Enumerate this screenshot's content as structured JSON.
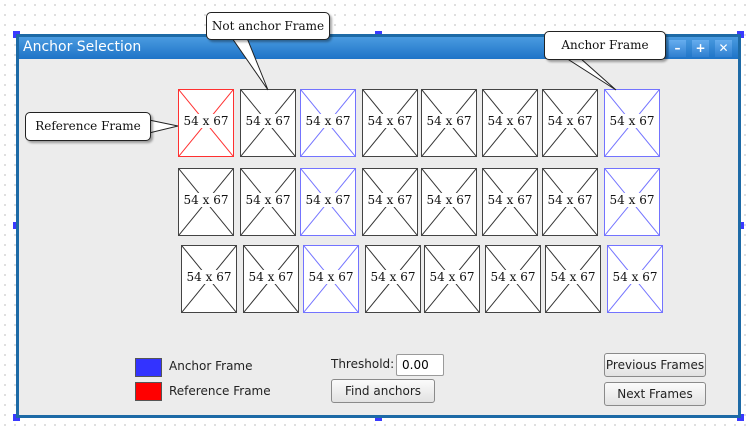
{
  "window": {
    "title": "Anchor Selection",
    "minimize_icon": "minimize-icon",
    "maximize_icon": "maximize-icon",
    "close_icon": "close-icon"
  },
  "frame_size_label": "54 x 67",
  "frame_rows": [
    [
      "reference",
      "normal",
      "anchor",
      "normal",
      "normal",
      "normal",
      "normal",
      "anchor"
    ],
    [
      "normal",
      "normal",
      "anchor",
      "normal",
      "normal",
      "normal",
      "normal",
      "anchor"
    ],
    [
      "normal",
      "normal",
      "anchor",
      "normal",
      "normal",
      "normal",
      "normal",
      "anchor"
    ]
  ],
  "callouts": {
    "not_anchor": "Not anchor Frame",
    "anchor": "Anchor Frame",
    "reference": "Reference Frame"
  },
  "legend": {
    "anchor_label": "Anchor Frame",
    "anchor_color": "#3333ff",
    "reference_label": "Reference Frame",
    "reference_color": "#ff0000"
  },
  "threshold": {
    "label": "Threshold:",
    "value": "0.00"
  },
  "buttons": {
    "find_anchors": "Find anchors",
    "previous_frames": "Previous Frames",
    "next_frames": "Next Frames"
  }
}
